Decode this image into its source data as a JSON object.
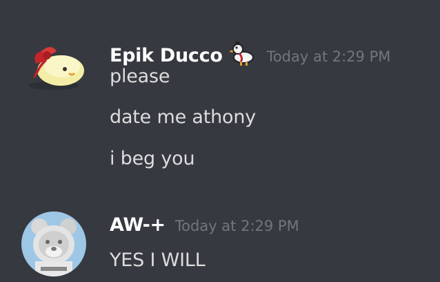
{
  "messages": [
    {
      "author": "Epik Ducco",
      "author_badge_icon": "duck-icon",
      "timestamp": "Today at 2:29 PM",
      "lines": [
        "please",
        "date me athony",
        "i beg you"
      ]
    },
    {
      "author": "AW-+",
      "timestamp": "Today at 2:29 PM",
      "lines": [
        "YES I WILL"
      ]
    }
  ],
  "colors": {
    "background": "#36393f",
    "username": "#ffffff",
    "message_text": "#dcddde",
    "timestamp": "#72767d"
  }
}
